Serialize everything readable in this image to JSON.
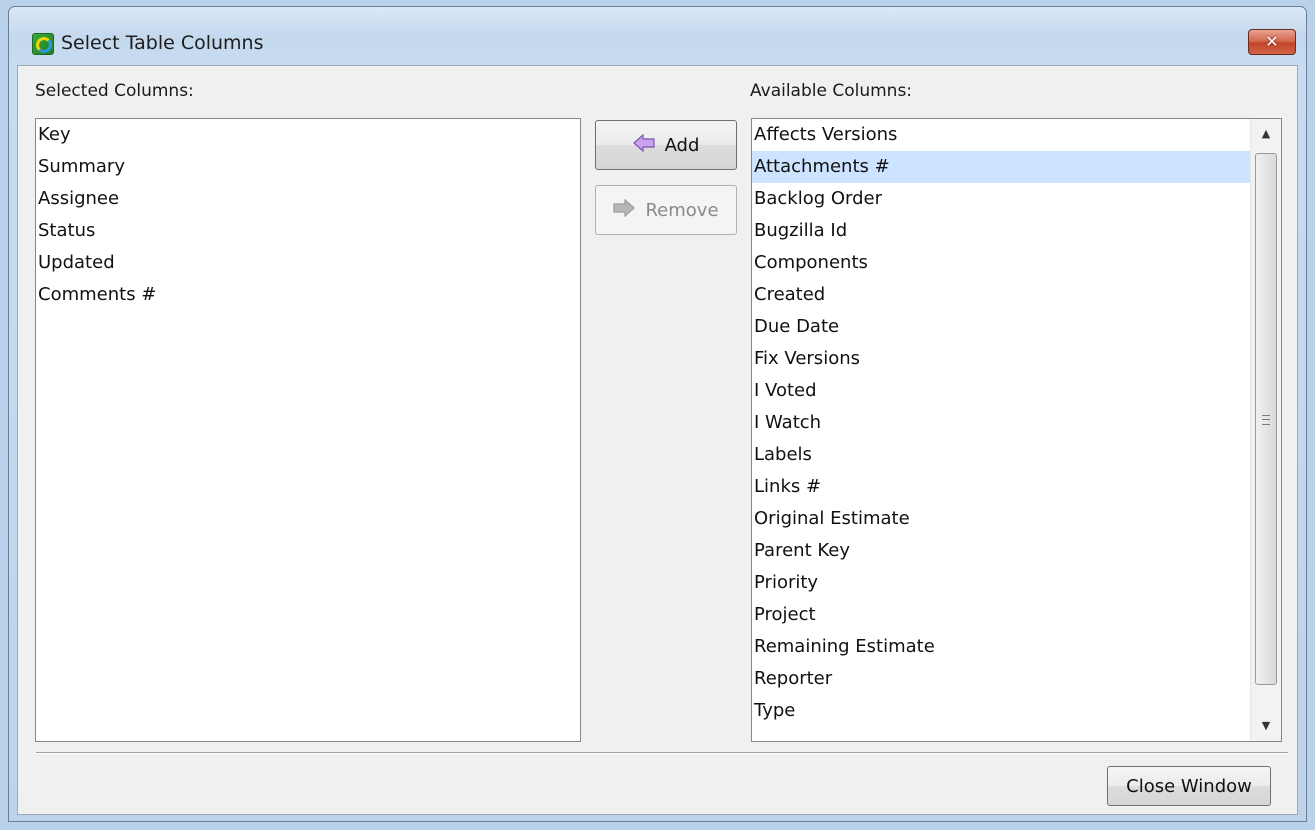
{
  "window": {
    "title": "Select Table Columns",
    "close_glyph": "✕"
  },
  "selected_columns": {
    "label": "Selected Columns:",
    "items": [
      "Key",
      "Summary",
      "Assignee",
      "Status",
      "Updated",
      "Comments #"
    ]
  },
  "available_columns": {
    "label": "Available Columns:",
    "items": [
      "Affects Versions",
      "Attachments #",
      "Backlog Order",
      "Bugzilla Id",
      "Components",
      "Created",
      "Due Date",
      "Fix Versions",
      "I Voted",
      "I Watch",
      "Labels",
      "Links #",
      "Original Estimate",
      "Parent Key",
      "Priority",
      "Project",
      "Remaining Estimate",
      "Reporter",
      "Type"
    ],
    "selected_item": "Attachments #"
  },
  "buttons": {
    "add_label": "Add",
    "remove_label": "Remove",
    "close_window_label": "Close Window"
  },
  "icons": {
    "add": "arrow-left-icon",
    "remove": "arrow-right-icon",
    "app": "app-icon"
  },
  "colors": {
    "selection": "#cce4ff",
    "add_arrow": "#b58ae0",
    "remove_arrow": "#a8a8a8"
  }
}
